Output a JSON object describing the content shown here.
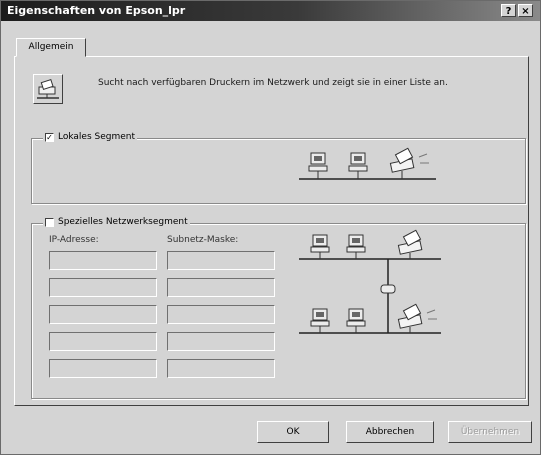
{
  "window": {
    "title": "Eigenschaften von Epson_lpr",
    "help_label": "?",
    "close_label": "×"
  },
  "tabs": [
    {
      "label": "Allgemein"
    }
  ],
  "general": {
    "description": "Sucht nach verfügbaren Druckern im Netzwerk und zeigt sie in einer Liste an.",
    "network_icon": "network-printer-icon"
  },
  "local_segment": {
    "label": "Lokales Segment",
    "checked": true,
    "check_mark": "✓"
  },
  "special_segment": {
    "label": "Spezielles Netzwerksegment",
    "checked": false,
    "ip_label": "IP-Adresse:",
    "mask_label": "Subnetz-Maske:",
    "rows": [
      {
        "ip": "",
        "mask": ""
      },
      {
        "ip": "",
        "mask": ""
      },
      {
        "ip": "",
        "mask": ""
      },
      {
        "ip": "",
        "mask": ""
      },
      {
        "ip": "",
        "mask": ""
      }
    ]
  },
  "buttons": {
    "ok": "OK",
    "cancel": "Abbrechen",
    "apply": "Übernehmen",
    "apply_enabled": false
  }
}
